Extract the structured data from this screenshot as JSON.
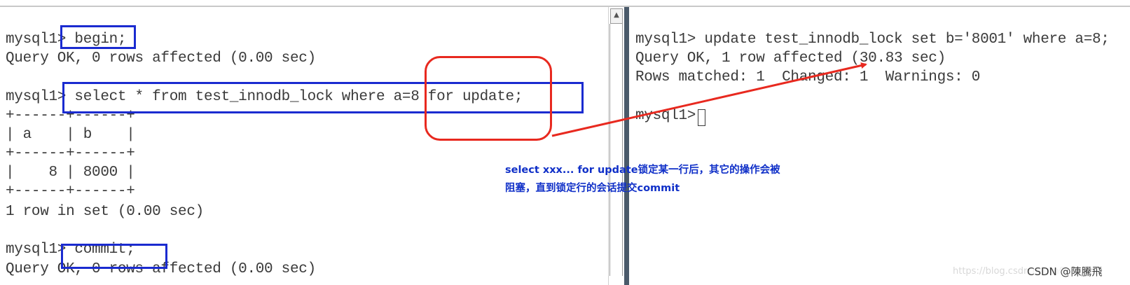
{
  "left_terminal": {
    "lines": [
      "mysql1> begin;",
      "Query OK, 0 rows affected (0.00 sec)",
      "",
      "mysql1> select * from test_innodb_lock where a=8 for update;",
      "+------+------+",
      "| a    | b    |",
      "+------+------+",
      "|    8 | 8000 |",
      "+------+------+",
      "1 row in set (0.00 sec)",
      "",
      "mysql1> commit;",
      "Query OK, 0 rows affected (0.00 sec)"
    ]
  },
  "right_terminal": {
    "lines": [
      "mysql1> update test_innodb_lock set b='8001' where a=8;",
      "Query OK, 1 row affected (30.83 sec)",
      "Rows matched: 1  Changed: 1  Warnings: 0",
      "",
      "mysql1> "
    ]
  },
  "annotation": {
    "line1": "select xxx... for update锁定某一行后，其它的操作会被",
    "line2": "阻塞，直到锁定行的会话提交commit"
  },
  "watermark": {
    "faint": "https://blog.csdn.net/m0_...",
    "text": "CSDN @陳騰飛"
  },
  "scrollbar": {
    "up_icon": "▲"
  },
  "colors": {
    "highlight_box": "#1a2bd0",
    "callout": "#e8291f",
    "annotation_text": "#1030c8"
  }
}
